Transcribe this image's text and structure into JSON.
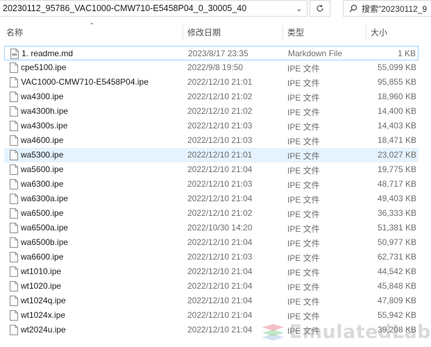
{
  "address_bar": {
    "path": "20230112_95786_VAC1000-CMW710-E5458P04_0_30005_40"
  },
  "search": {
    "placeholder": "搜索\"20230112_9"
  },
  "columns": {
    "name": "名称",
    "date": "修改日期",
    "type": "类型",
    "size": "大小"
  },
  "files": [
    {
      "name": "1. readme.md",
      "date": "2023/8/17 23:35",
      "type": "Markdown File",
      "size": "1 KB",
      "icon": "markdown-file-icon"
    },
    {
      "name": "cpe5100.ipe",
      "date": "2022/9/8 19:50",
      "type": "IPE 文件",
      "size": "55,099 KB",
      "icon": "file-icon"
    },
    {
      "name": "VAC1000-CMW710-E5458P04.ipe",
      "date": "2022/12/10 21:01",
      "type": "IPE 文件",
      "size": "95,855 KB",
      "icon": "file-icon"
    },
    {
      "name": "wa4300.ipe",
      "date": "2022/12/10 21:02",
      "type": "IPE 文件",
      "size": "18,960 KB",
      "icon": "file-icon"
    },
    {
      "name": "wa4300h.ipe",
      "date": "2022/12/10 21:02",
      "type": "IPE 文件",
      "size": "14,400 KB",
      "icon": "file-icon"
    },
    {
      "name": "wa4300s.ipe",
      "date": "2022/12/10 21:03",
      "type": "IPE 文件",
      "size": "14,403 KB",
      "icon": "file-icon"
    },
    {
      "name": "wa4600.ipe",
      "date": "2022/12/10 21:03",
      "type": "IPE 文件",
      "size": "18,471 KB",
      "icon": "file-icon"
    },
    {
      "name": "wa5300.ipe",
      "date": "2022/12/10 21:01",
      "type": "IPE 文件",
      "size": "23,027 KB",
      "icon": "file-icon"
    },
    {
      "name": "wa5600.ipe",
      "date": "2022/12/10 21:04",
      "type": "IPE 文件",
      "size": "19,775 KB",
      "icon": "file-icon"
    },
    {
      "name": "wa6300.ipe",
      "date": "2022/12/10 21:03",
      "type": "IPE 文件",
      "size": "48,717 KB",
      "icon": "file-icon"
    },
    {
      "name": "wa6300a.ipe",
      "date": "2022/12/10 21:04",
      "type": "IPE 文件",
      "size": "49,403 KB",
      "icon": "file-icon"
    },
    {
      "name": "wa6500.ipe",
      "date": "2022/12/10 21:02",
      "type": "IPE 文件",
      "size": "36,333 KB",
      "icon": "file-icon"
    },
    {
      "name": "wa6500a.ipe",
      "date": "2022/10/30 14:20",
      "type": "IPE 文件",
      "size": "51,381 KB",
      "icon": "file-icon"
    },
    {
      "name": "wa6500b.ipe",
      "date": "2022/12/10 21:04",
      "type": "IPE 文件",
      "size": "50,977 KB",
      "icon": "file-icon"
    },
    {
      "name": "wa6600.ipe",
      "date": "2022/12/10 21:03",
      "type": "IPE 文件",
      "size": "62,731 KB",
      "icon": "file-icon"
    },
    {
      "name": "wt1010.ipe",
      "date": "2022/12/10 21:04",
      "type": "IPE 文件",
      "size": "44,542 KB",
      "icon": "file-icon"
    },
    {
      "name": "wt1020.ipe",
      "date": "2022/12/10 21:04",
      "type": "IPE 文件",
      "size": "45,848 KB",
      "icon": "file-icon"
    },
    {
      "name": "wt1024q.ipe",
      "date": "2022/12/10 21:04",
      "type": "IPE 文件",
      "size": "47,809 KB",
      "icon": "file-icon"
    },
    {
      "name": "wt1024x.ipe",
      "date": "2022/12/10 21:04",
      "type": "IPE 文件",
      "size": "55,942 KB",
      "icon": "file-icon"
    },
    {
      "name": "wt2024u.ipe",
      "date": "2022/12/10 21:04",
      "type": "IPE 文件",
      "size": "39,208 KB",
      "icon": "file-icon"
    }
  ],
  "state": {
    "focused_row": 0,
    "selected_row": 7
  },
  "watermark": {
    "text": "EmulatedLab"
  },
  "colors": {
    "selection": "#e5f3ff",
    "focus_border": "#99d1ff",
    "secondary_text": "#6d6d6d"
  }
}
